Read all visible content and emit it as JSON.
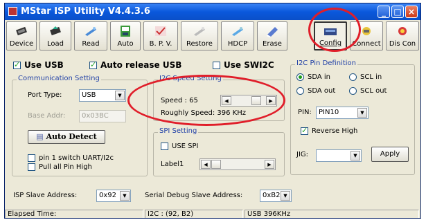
{
  "window": {
    "title": "MStar ISP Utility V4.4.3.6"
  },
  "toolbar": {
    "buttons": [
      {
        "label": "Device",
        "icon": "chip-icon"
      },
      {
        "label": "Load",
        "icon": "chip-load-icon"
      },
      {
        "label": "Read",
        "icon": "read-icon"
      },
      {
        "label": "Auto",
        "icon": "auto-icon"
      },
      {
        "label": "B. P. V.",
        "icon": "check-icon"
      },
      {
        "label": "Restore",
        "icon": "restore-icon"
      },
      {
        "label": "HDCP",
        "icon": "hdcp-icon"
      },
      {
        "label": "Erase",
        "icon": "eraser-icon"
      },
      {
        "label": "Config",
        "icon": "config-icon"
      },
      {
        "label": "Connect",
        "icon": "connect-icon"
      },
      {
        "label": "Dis Con",
        "icon": "disconnect-icon"
      }
    ],
    "active": "Config"
  },
  "top_checks": {
    "use_usb": "Use USB",
    "auto_release_usb": "Auto release USB",
    "use_swi2c": "Use SWI2C"
  },
  "comm": {
    "legend": "Communication Setting",
    "port_type_label": "Port Type:",
    "port_type_value": "USB",
    "base_addr_label": "Base Addr:",
    "base_addr_value": "0x03BC",
    "auto_detect": "Auto Detect",
    "pin1_switch": "pin 1 switch UART/I2c",
    "pull_all_pin": "Pull all Pin High"
  },
  "i2c_speed": {
    "legend": "I2C Speed Setting",
    "speed_label": "Speed :",
    "speed_value": "65",
    "roughly_speed": "Roughly Speed: 396 KHz"
  },
  "spi": {
    "legend": "SPI Setting",
    "use_spi": "USE SPI",
    "label1": "Label1"
  },
  "i2c_pin": {
    "legend": "I2C Pin Definition",
    "sda_in": "SDA in",
    "scl_in": "SCL in",
    "sda_out": "SDA out",
    "scl_out": "SCL out",
    "pin_label": "PIN:",
    "pin_value": "PIN10",
    "reverse_high": "Reverse High",
    "jig_label": "JIG:",
    "jig_value": "",
    "apply": "Apply"
  },
  "bottom": {
    "isp_slave_label": "ISP Slave Address:",
    "isp_slave_value": "0x92",
    "serial_debug_label": "Serial Debug Slave Address:",
    "serial_debug_value": "0xB2"
  },
  "status": {
    "elapsed": "Elapsed Time:",
    "i2c": "I2C : (92, B2)",
    "usb": "USB  396KHz"
  },
  "colors": {
    "titlebar": "#0a58dc",
    "annotation": "#e01e2a",
    "legend_text": "#1f3fa6"
  }
}
